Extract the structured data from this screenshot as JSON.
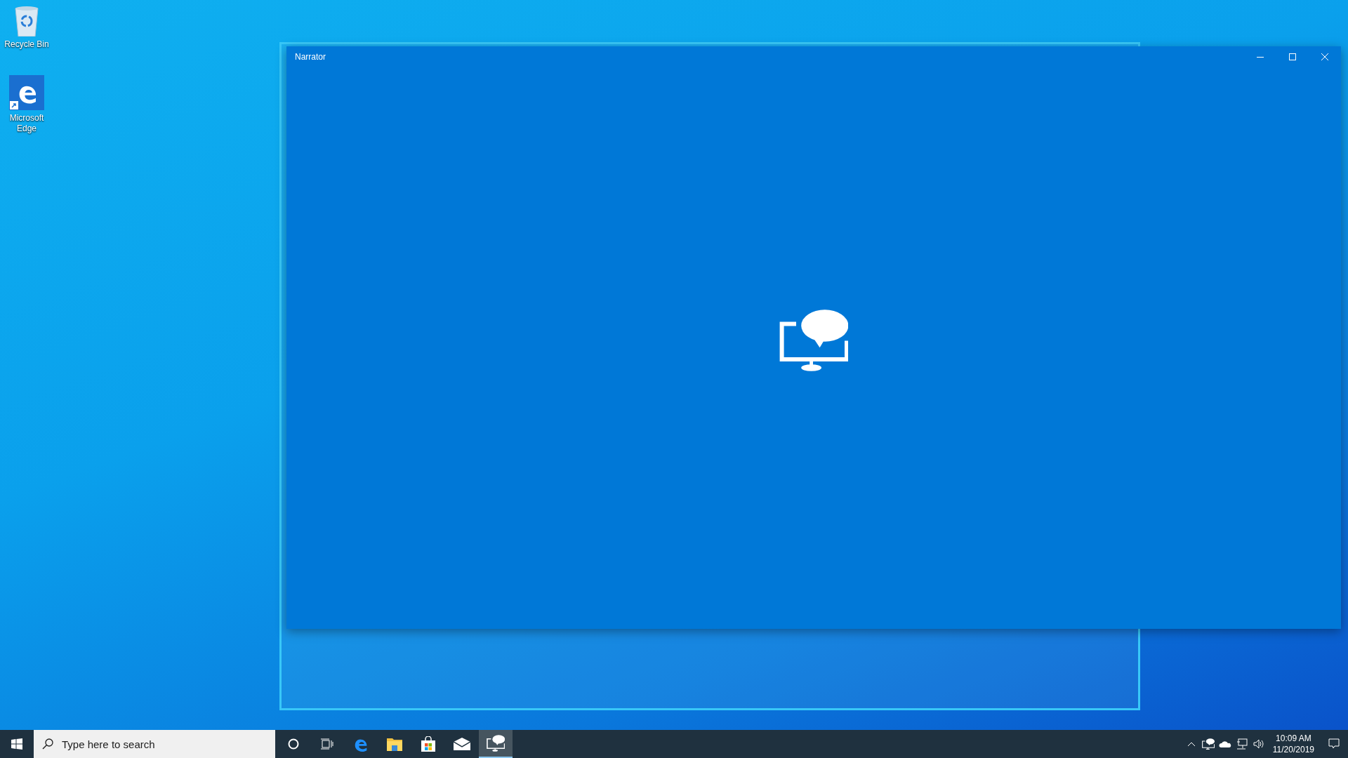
{
  "desktop_icons": [
    {
      "kind": "recycle",
      "label": "Recycle Bin"
    },
    {
      "kind": "edge",
      "label": "Microsoft Edge"
    }
  ],
  "window": {
    "title": "Narrator"
  },
  "taskbar": {
    "search": {
      "placeholder": "Type here to search"
    },
    "apps": [
      {
        "kind": "edge",
        "selected": false
      },
      {
        "kind": "explorer",
        "selected": false
      },
      {
        "kind": "store",
        "selected": false
      },
      {
        "kind": "mail",
        "selected": false
      },
      {
        "kind": "narrator",
        "selected": true
      }
    ],
    "clock": {
      "time": "10:09 AM",
      "date": "11/20/2019"
    }
  }
}
